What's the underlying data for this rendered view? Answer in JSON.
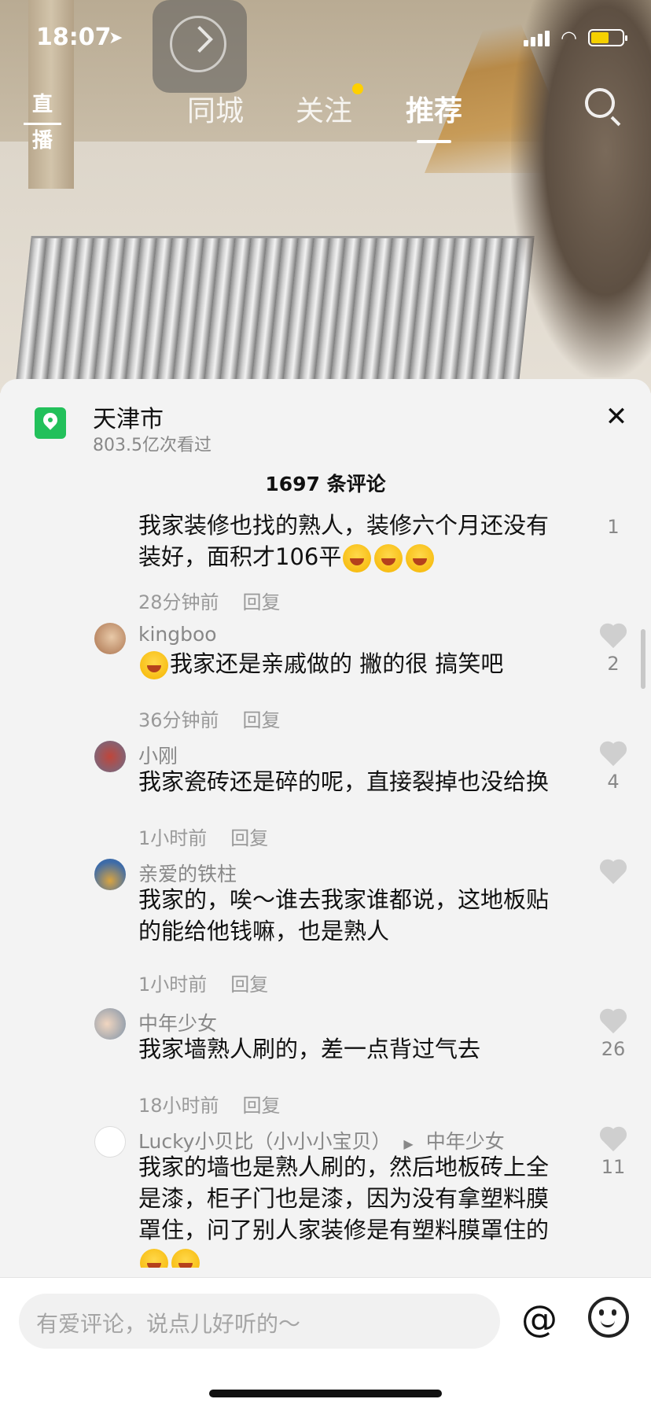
{
  "status_bar": {
    "time": "18:07"
  },
  "top_nav": {
    "live_label": "直播",
    "tabs": [
      {
        "label": "同城"
      },
      {
        "label": "关注"
      },
      {
        "label": "推荐"
      }
    ]
  },
  "location": {
    "title": "天津市",
    "views": "803.5亿次看过"
  },
  "comment_count": "1697 条评论",
  "comments": [
    {
      "user": "",
      "text": "我家装修也找的熟人，装修六个月还没有装好，面积才106平",
      "time": "28分钟前",
      "reply": "回复",
      "likes": "1"
    },
    {
      "user": "kingboo",
      "text": "我家还是亲戚做的 撇的很 搞笑吧",
      "time": "36分钟前",
      "reply": "回复",
      "likes": "2"
    },
    {
      "user": "小刚",
      "text": "我家瓷砖还是碎的呢，直接裂掉也没给换",
      "time": "1小时前",
      "reply": "回复",
      "likes": "4"
    },
    {
      "user": "亲爱的铁柱",
      "text": "我家的，唉～谁去我家谁都说，这地板贴的能给他钱嘛，也是熟人",
      "time": "1小时前",
      "reply": "回复",
      "likes": ""
    },
    {
      "user": "中年少女",
      "text": "我家墙熟人刷的，差一点背过气去",
      "time": "18小时前",
      "reply": "回复",
      "likes": "26"
    },
    {
      "user": "Lucky小贝比（小小小宝贝）",
      "reply_to": "中年少女",
      "text": "我家的墙也是熟人刷的，然后地板砖上全是漆，柜子门也是漆，因为没有拿塑料膜罩住，问了别人家装修是有塑料膜罩住的",
      "likes": "11"
    }
  ],
  "input": {
    "placeholder": "有爱评论，说点儿好听的～",
    "at_symbol": "@"
  }
}
